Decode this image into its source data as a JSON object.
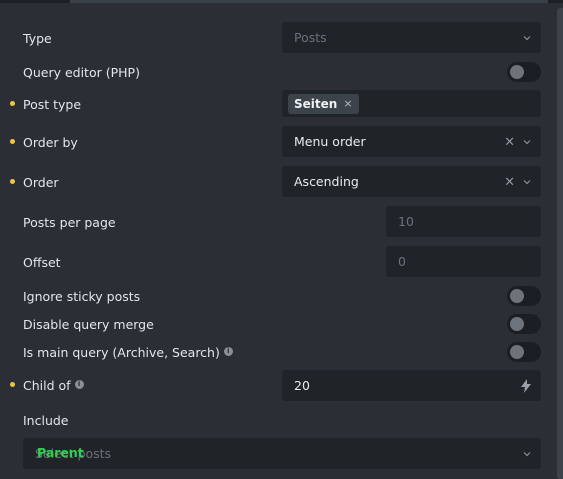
{
  "fields": {
    "type": {
      "label": "Type",
      "value": "Posts"
    },
    "query_editor": {
      "label": "Query editor (PHP)"
    },
    "post_type": {
      "label": "Post type",
      "tag": "Seiten",
      "tag_remove": "×"
    },
    "order_by": {
      "label": "Order by",
      "value": "Menu order",
      "clear": "×"
    },
    "order": {
      "label": "Order",
      "value": "Ascending",
      "clear": "×"
    },
    "posts_per_page": {
      "label": "Posts per page",
      "placeholder": "10"
    },
    "offset": {
      "label": "Offset",
      "placeholder": "0"
    },
    "ignore_sticky": {
      "label": "Ignore sticky posts"
    },
    "disable_merge": {
      "label": "Disable query merge"
    },
    "main_query": {
      "label": "Is main query (Archive, Search)"
    },
    "child_of": {
      "label": "Child of",
      "value": "20"
    },
    "include": {
      "label": "Include",
      "placeholder": "Select posts"
    }
  },
  "overlay_label": "Parent",
  "colors": {
    "background": "#2b2f35",
    "control": "#202328",
    "accent_dot": "#f2c33e",
    "overlay_text": "#2fd14a"
  }
}
